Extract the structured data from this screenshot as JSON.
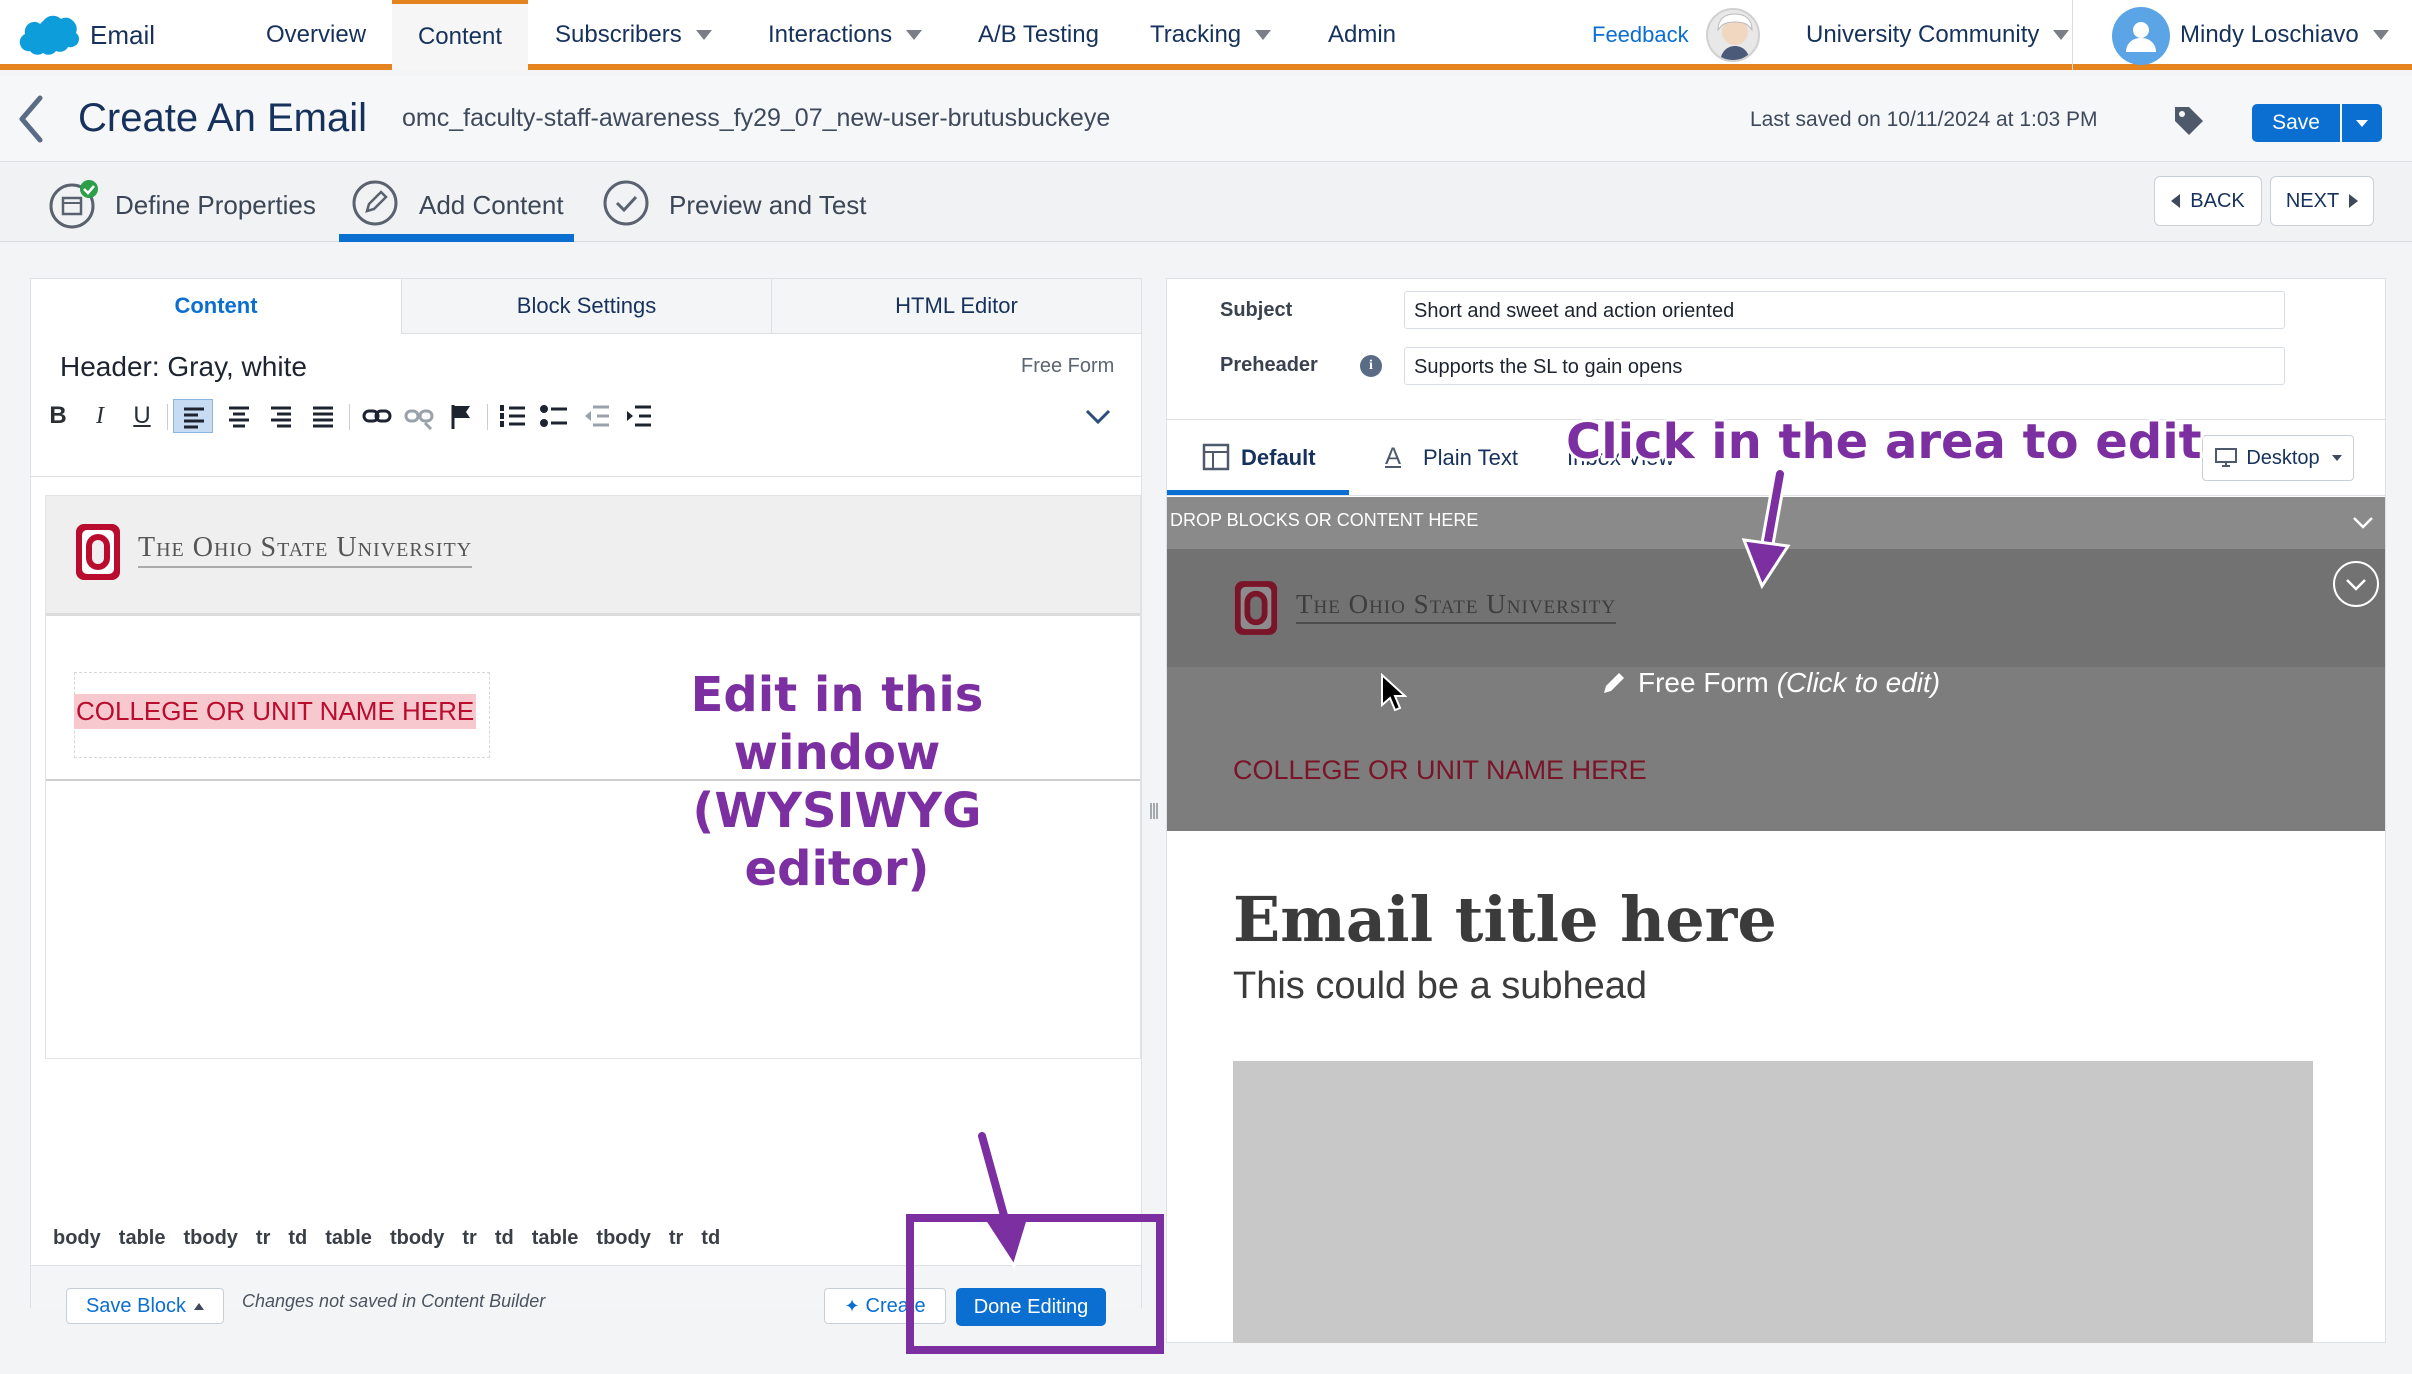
{
  "nav": {
    "app_name": "Email",
    "items": [
      {
        "label": "Overview"
      },
      {
        "label": "Content"
      },
      {
        "label": "Subscribers"
      },
      {
        "label": "Interactions"
      },
      {
        "label": "A/B Testing"
      },
      {
        "label": "Tracking"
      },
      {
        "label": "Admin"
      }
    ],
    "feedback": "Feedback",
    "business_unit": "University Community",
    "user": "Mindy Loschiavo"
  },
  "header": {
    "title": "Create An Email",
    "email_name": "omc_faculty-staff-awareness_fy29_07_new-user-brutusbuckeye",
    "last_saved": "Last saved on 10/11/2024 at 1:03 PM",
    "save_label": "Save"
  },
  "steps": {
    "items": [
      {
        "label": "Define Properties"
      },
      {
        "label": "Add Content"
      },
      {
        "label": "Preview and Test"
      }
    ],
    "back": "BACK",
    "next": "NEXT"
  },
  "editor": {
    "tabs": [
      {
        "label": "Content"
      },
      {
        "label": "Block Settings"
      },
      {
        "label": "HTML Editor"
      }
    ],
    "block_title": "Header: Gray, white",
    "block_type": "Free Form",
    "toolbar": {
      "bold": "B",
      "italic": "I",
      "underline": "U"
    },
    "logo_text": "The Ohio State University",
    "college_text": "COLLEGE OR UNIT NAME HERE",
    "breadcrumb": [
      "body",
      "table",
      "tbody",
      "tr",
      "td",
      "table",
      "tbody",
      "tr",
      "td",
      "table",
      "tbody",
      "tr",
      "td"
    ],
    "save_block": "Save Block",
    "status": "Changes not saved in Content Builder",
    "create": "Create",
    "done": "Done Editing"
  },
  "preview": {
    "subject_label": "Subject",
    "subject_value": "Short and sweet and action oriented",
    "preheader_label": "Preheader",
    "preheader_value": "Supports the SL to gain opens",
    "tabs": [
      {
        "label": "Default"
      },
      {
        "label": "Plain Text"
      },
      {
        "label": "Inbox View"
      }
    ],
    "device": "Desktop",
    "drop_zone": "DROP BLOCKS OR CONTENT HERE",
    "logo_text": "The Ohio State University",
    "freeform_label": "Free Form",
    "freeform_hint": "(Click to edit)",
    "college_text": "COLLEGE OR UNIT NAME HERE",
    "email_title": "Email title here",
    "subhead": "This could be a subhead"
  },
  "annotations": {
    "left": "Edit in this window (WYSIWYG editor)",
    "right": "Click in the area to edit"
  },
  "colors": {
    "accent_orange": "#e5831e",
    "brand_blue": "#0b6fd1",
    "osu_scarlet": "#ba0c2f",
    "annotation_purple": "#7b2fa0"
  }
}
